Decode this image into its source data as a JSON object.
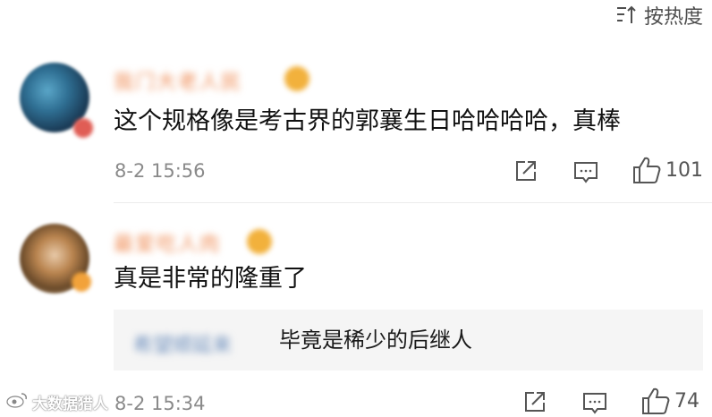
{
  "sort": {
    "label": "按热度",
    "icon": "sort-icon"
  },
  "comments": [
    {
      "username": "我门大老人民",
      "content": "这个规格像是考古界的郭襄生日哈哈哈哈，真棒",
      "time": "8-2 15:56",
      "likes": "101"
    },
    {
      "username": "最爱吃人肉",
      "content": "真是非常的隆重了",
      "time": "8-2 15:34",
      "likes": "74",
      "reply": {
        "username": "希望顺延来",
        "text": "毕竟是稀少的后继人"
      }
    }
  ],
  "watermark": "大数据猎人",
  "colors": {
    "username": "#ef8a52",
    "reply_username": "#6d8fbd",
    "icon_gray": "#555555"
  },
  "icons": [
    "share-icon",
    "comment-icon",
    "like-icon"
  ]
}
